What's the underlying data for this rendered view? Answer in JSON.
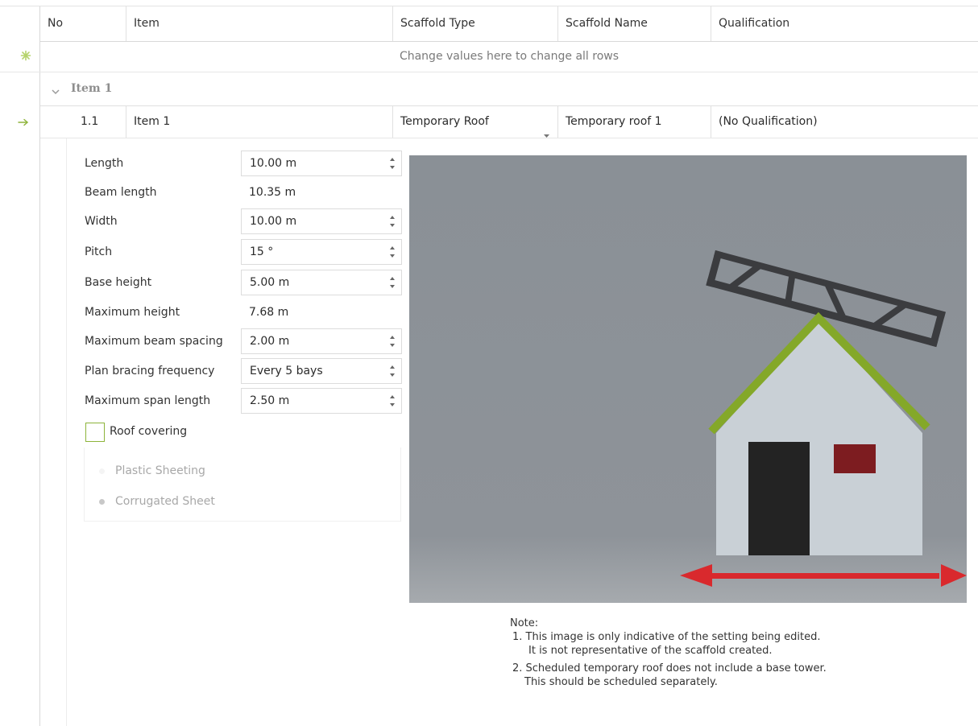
{
  "grid": {
    "columns": {
      "no": "No",
      "item": "Item",
      "scaffold_type": "Scaffold Type",
      "scaffold_name": "Scaffold Name",
      "qualification": "Qualification"
    },
    "filter_row_text": "Change values here to change all rows",
    "group_label": "Item 1",
    "row": {
      "no": "1.1",
      "item": "Item 1",
      "scaffold_type": "Temporary Roof",
      "scaffold_name": "Temporary roof 1",
      "qualification": "(No Qualification)"
    }
  },
  "settings": {
    "length": {
      "label": "Length",
      "value": "10.00 m"
    },
    "beam_length": {
      "label": "Beam length",
      "value": "10.35 m"
    },
    "width": {
      "label": "Width",
      "value": "10.00 m"
    },
    "pitch": {
      "label": "Pitch",
      "value": "15 °"
    },
    "base_height": {
      "label": "Base height",
      "value": "5.00 m"
    },
    "maximum_height": {
      "label": "Maximum height",
      "value": "7.68 m"
    },
    "maximum_beam_spacing": {
      "label": "Maximum beam spacing",
      "value": "2.00 m"
    },
    "plan_bracing_frequency": {
      "label": "Plan bracing frequency",
      "value": "Every 5 bays"
    },
    "maximum_span_length": {
      "label": "Maximum span length",
      "value": "2.50 m"
    },
    "roof_covering": {
      "label": "Roof covering",
      "checked": false
    },
    "covering_options": [
      "Plastic Sheeting",
      "Corrugated Sheet"
    ],
    "covering_selected": "Corrugated Sheet"
  },
  "note": {
    "heading": "Note:",
    "line1a": "1. This image is only indicative of the setting being edited.",
    "line1b": "It is not representative of the scaffold created.",
    "line2a": "2. Scheduled temporary roof does not include a base tower.",
    "line2b": "This should be scheduled separately."
  },
  "colors": {
    "accent_green": "#8db43a",
    "arrow_red": "#d9292d",
    "preview_bg": "#8c9197"
  },
  "icons": {
    "new_row": "sparkle-icon",
    "current_row": "arrow-right-icon",
    "group_expand": "chevron-down-icon",
    "dropdown": "dropdown-arrow-icon",
    "spinner": "spinner-arrows-icon"
  }
}
